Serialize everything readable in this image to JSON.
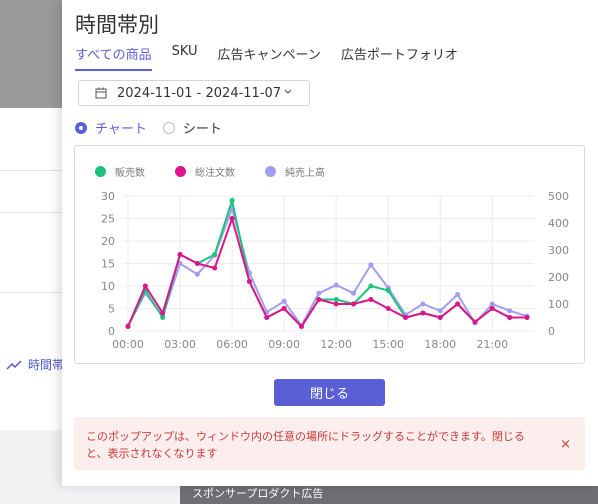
{
  "background": {
    "link_label": "時間帯",
    "table_header": "スポンサープロダクト広告"
  },
  "popup": {
    "title": "時間帯別",
    "tabs": [
      {
        "label": "すべての商品",
        "active": true
      },
      {
        "label": "SKU",
        "active": false
      },
      {
        "label": "広告キャンペーン",
        "active": false
      },
      {
        "label": "広告ポートフォリオ",
        "active": false
      }
    ],
    "date_range": "2024-11-01 - 2024-11-07",
    "view_options": [
      {
        "label": "チャート",
        "selected": true
      },
      {
        "label": "シート",
        "selected": false
      }
    ],
    "close_label": "閉じる",
    "notice": "このポップアップは、ウィンドウ内の任意の場所にドラッグすることができます。閉じると、表示されなくなります",
    "notice_close": "×"
  },
  "chart_data": {
    "type": "line",
    "x_ticks": [
      "00:00",
      "03:00",
      "06:00",
      "09:00",
      "12:00",
      "15:00",
      "18:00",
      "21:00"
    ],
    "x": [
      0,
      1,
      2,
      3,
      4,
      5,
      6,
      7,
      8,
      9,
      10,
      11,
      12,
      13,
      14,
      15,
      16,
      17,
      18,
      19,
      20,
      21,
      22,
      23
    ],
    "y_left": {
      "ticks": [
        0,
        5,
        10,
        15,
        20,
        25,
        30
      ],
      "lim": [
        0,
        30
      ]
    },
    "y_right": {
      "ticks": [
        0,
        100,
        200,
        300,
        400,
        500
      ],
      "lim": [
        0,
        500
      ]
    },
    "grid": true,
    "legend_position": "top-left",
    "series": [
      {
        "name": "販売数",
        "color": "#1bc47d",
        "axis": "left",
        "values": [
          1,
          9,
          3,
          17,
          15,
          17,
          29,
          11,
          3,
          5,
          1,
          7,
          7,
          6,
          10,
          9,
          3,
          4,
          3,
          6,
          2,
          5,
          3,
          3
        ]
      },
      {
        "name": "総注文数",
        "color": "#e0148a",
        "axis": "left",
        "values": [
          1,
          10,
          4,
          17,
          15,
          14,
          25,
          11,
          3,
          5,
          1,
          7,
          6,
          6,
          7,
          5,
          3,
          4,
          3,
          6,
          2,
          5,
          3,
          3
        ]
      },
      {
        "name": "純売上高",
        "color": "#a49cf2",
        "axis": "right",
        "values": [
          20,
          140,
          55,
          250,
          210,
          280,
          455,
          215,
          70,
          110,
          20,
          140,
          170,
          140,
          245,
          160,
          60,
          100,
          75,
          135,
          30,
          100,
          75,
          55
        ]
      }
    ]
  }
}
